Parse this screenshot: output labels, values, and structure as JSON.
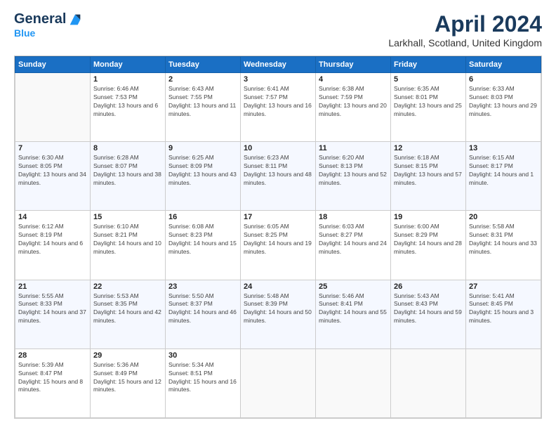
{
  "header": {
    "logo_general": "General",
    "logo_blue": "Blue",
    "month_title": "April 2024",
    "location": "Larkhall, Scotland, United Kingdom"
  },
  "days_of_week": [
    "Sunday",
    "Monday",
    "Tuesday",
    "Wednesday",
    "Thursday",
    "Friday",
    "Saturday"
  ],
  "weeks": [
    [
      {
        "day": "",
        "sunrise": "",
        "sunset": "",
        "daylight": ""
      },
      {
        "day": "1",
        "sunrise": "Sunrise: 6:46 AM",
        "sunset": "Sunset: 7:53 PM",
        "daylight": "Daylight: 13 hours and 6 minutes."
      },
      {
        "day": "2",
        "sunrise": "Sunrise: 6:43 AM",
        "sunset": "Sunset: 7:55 PM",
        "daylight": "Daylight: 13 hours and 11 minutes."
      },
      {
        "day": "3",
        "sunrise": "Sunrise: 6:41 AM",
        "sunset": "Sunset: 7:57 PM",
        "daylight": "Daylight: 13 hours and 16 minutes."
      },
      {
        "day": "4",
        "sunrise": "Sunrise: 6:38 AM",
        "sunset": "Sunset: 7:59 PM",
        "daylight": "Daylight: 13 hours and 20 minutes."
      },
      {
        "day": "5",
        "sunrise": "Sunrise: 6:35 AM",
        "sunset": "Sunset: 8:01 PM",
        "daylight": "Daylight: 13 hours and 25 minutes."
      },
      {
        "day": "6",
        "sunrise": "Sunrise: 6:33 AM",
        "sunset": "Sunset: 8:03 PM",
        "daylight": "Daylight: 13 hours and 29 minutes."
      }
    ],
    [
      {
        "day": "7",
        "sunrise": "Sunrise: 6:30 AM",
        "sunset": "Sunset: 8:05 PM",
        "daylight": "Daylight: 13 hours and 34 minutes."
      },
      {
        "day": "8",
        "sunrise": "Sunrise: 6:28 AM",
        "sunset": "Sunset: 8:07 PM",
        "daylight": "Daylight: 13 hours and 38 minutes."
      },
      {
        "day": "9",
        "sunrise": "Sunrise: 6:25 AM",
        "sunset": "Sunset: 8:09 PM",
        "daylight": "Daylight: 13 hours and 43 minutes."
      },
      {
        "day": "10",
        "sunrise": "Sunrise: 6:23 AM",
        "sunset": "Sunset: 8:11 PM",
        "daylight": "Daylight: 13 hours and 48 minutes."
      },
      {
        "day": "11",
        "sunrise": "Sunrise: 6:20 AM",
        "sunset": "Sunset: 8:13 PM",
        "daylight": "Daylight: 13 hours and 52 minutes."
      },
      {
        "day": "12",
        "sunrise": "Sunrise: 6:18 AM",
        "sunset": "Sunset: 8:15 PM",
        "daylight": "Daylight: 13 hours and 57 minutes."
      },
      {
        "day": "13",
        "sunrise": "Sunrise: 6:15 AM",
        "sunset": "Sunset: 8:17 PM",
        "daylight": "Daylight: 14 hours and 1 minute."
      }
    ],
    [
      {
        "day": "14",
        "sunrise": "Sunrise: 6:12 AM",
        "sunset": "Sunset: 8:19 PM",
        "daylight": "Daylight: 14 hours and 6 minutes."
      },
      {
        "day": "15",
        "sunrise": "Sunrise: 6:10 AM",
        "sunset": "Sunset: 8:21 PM",
        "daylight": "Daylight: 14 hours and 10 minutes."
      },
      {
        "day": "16",
        "sunrise": "Sunrise: 6:08 AM",
        "sunset": "Sunset: 8:23 PM",
        "daylight": "Daylight: 14 hours and 15 minutes."
      },
      {
        "day": "17",
        "sunrise": "Sunrise: 6:05 AM",
        "sunset": "Sunset: 8:25 PM",
        "daylight": "Daylight: 14 hours and 19 minutes."
      },
      {
        "day": "18",
        "sunrise": "Sunrise: 6:03 AM",
        "sunset": "Sunset: 8:27 PM",
        "daylight": "Daylight: 14 hours and 24 minutes."
      },
      {
        "day": "19",
        "sunrise": "Sunrise: 6:00 AM",
        "sunset": "Sunset: 8:29 PM",
        "daylight": "Daylight: 14 hours and 28 minutes."
      },
      {
        "day": "20",
        "sunrise": "Sunrise: 5:58 AM",
        "sunset": "Sunset: 8:31 PM",
        "daylight": "Daylight: 14 hours and 33 minutes."
      }
    ],
    [
      {
        "day": "21",
        "sunrise": "Sunrise: 5:55 AM",
        "sunset": "Sunset: 8:33 PM",
        "daylight": "Daylight: 14 hours and 37 minutes."
      },
      {
        "day": "22",
        "sunrise": "Sunrise: 5:53 AM",
        "sunset": "Sunset: 8:35 PM",
        "daylight": "Daylight: 14 hours and 42 minutes."
      },
      {
        "day": "23",
        "sunrise": "Sunrise: 5:50 AM",
        "sunset": "Sunset: 8:37 PM",
        "daylight": "Daylight: 14 hours and 46 minutes."
      },
      {
        "day": "24",
        "sunrise": "Sunrise: 5:48 AM",
        "sunset": "Sunset: 8:39 PM",
        "daylight": "Daylight: 14 hours and 50 minutes."
      },
      {
        "day": "25",
        "sunrise": "Sunrise: 5:46 AM",
        "sunset": "Sunset: 8:41 PM",
        "daylight": "Daylight: 14 hours and 55 minutes."
      },
      {
        "day": "26",
        "sunrise": "Sunrise: 5:43 AM",
        "sunset": "Sunset: 8:43 PM",
        "daylight": "Daylight: 14 hours and 59 minutes."
      },
      {
        "day": "27",
        "sunrise": "Sunrise: 5:41 AM",
        "sunset": "Sunset: 8:45 PM",
        "daylight": "Daylight: 15 hours and 3 minutes."
      }
    ],
    [
      {
        "day": "28",
        "sunrise": "Sunrise: 5:39 AM",
        "sunset": "Sunset: 8:47 PM",
        "daylight": "Daylight: 15 hours and 8 minutes."
      },
      {
        "day": "29",
        "sunrise": "Sunrise: 5:36 AM",
        "sunset": "Sunset: 8:49 PM",
        "daylight": "Daylight: 15 hours and 12 minutes."
      },
      {
        "day": "30",
        "sunrise": "Sunrise: 5:34 AM",
        "sunset": "Sunset: 8:51 PM",
        "daylight": "Daylight: 15 hours and 16 minutes."
      },
      {
        "day": "",
        "sunrise": "",
        "sunset": "",
        "daylight": ""
      },
      {
        "day": "",
        "sunrise": "",
        "sunset": "",
        "daylight": ""
      },
      {
        "day": "",
        "sunrise": "",
        "sunset": "",
        "daylight": ""
      },
      {
        "day": "",
        "sunrise": "",
        "sunset": "",
        "daylight": ""
      }
    ]
  ]
}
